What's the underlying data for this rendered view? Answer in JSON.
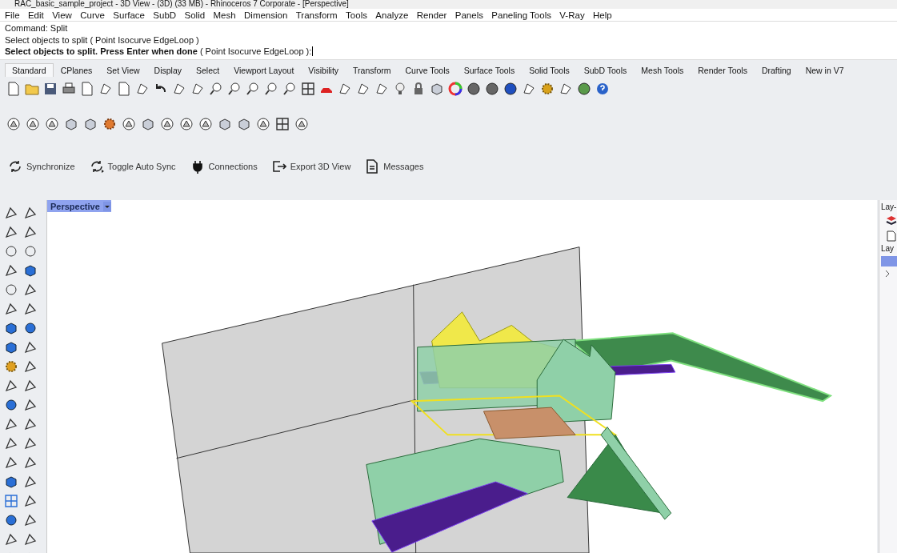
{
  "window": {
    "title": "RAC_basic_sample_project - 3D View - (3D) (33 MB) - Rhinoceros 7 Corporate - [Perspective]"
  },
  "menu": [
    "File",
    "Edit",
    "View",
    "Curve",
    "Surface",
    "SubD",
    "Solid",
    "Mesh",
    "Dimension",
    "Transform",
    "Tools",
    "Analyze",
    "Render",
    "Panels",
    "Paneling Tools",
    "V-Ray",
    "Help"
  ],
  "command": {
    "history": [
      "Command: Split",
      "Select objects to split ( Point  Isocurve  EdgeLoop )"
    ],
    "prompt": "**Select objects to split. Press Enter when done** ( Point  Isocurve  EdgeLoop ):"
  },
  "tabs": [
    {
      "label": "Standard",
      "selected": true
    },
    {
      "label": "CPlanes",
      "selected": false
    },
    {
      "label": "Set View",
      "selected": false
    },
    {
      "label": "Display",
      "selected": false
    },
    {
      "label": "Select",
      "selected": false
    },
    {
      "label": "Viewport Layout",
      "selected": false
    },
    {
      "label": "Visibility",
      "selected": false
    },
    {
      "label": "Transform",
      "selected": false
    },
    {
      "label": "Curve Tools",
      "selected": false
    },
    {
      "label": "Surface Tools",
      "selected": false
    },
    {
      "label": "Solid Tools",
      "selected": false
    },
    {
      "label": "SubD Tools",
      "selected": false
    },
    {
      "label": "Mesh Tools",
      "selected": false
    },
    {
      "label": "Render Tools",
      "selected": false
    },
    {
      "label": "Drafting",
      "selected": false
    },
    {
      "label": "New in V7",
      "selected": false
    }
  ],
  "plugin_toolbar": [
    {
      "label": "Synchronize",
      "kind": "sync"
    },
    {
      "label": "Toggle Auto Sync",
      "kind": "autosync"
    },
    {
      "label": "Connections",
      "kind": "plug"
    },
    {
      "label": "Export 3D View",
      "kind": "export"
    },
    {
      "label": "Messages",
      "kind": "doc"
    }
  ],
  "viewport": {
    "title": "Perspective"
  },
  "layers_panel": {
    "headers": [
      "Lay-",
      "Lay"
    ],
    "rows": [
      {
        "selected": true
      }
    ]
  }
}
